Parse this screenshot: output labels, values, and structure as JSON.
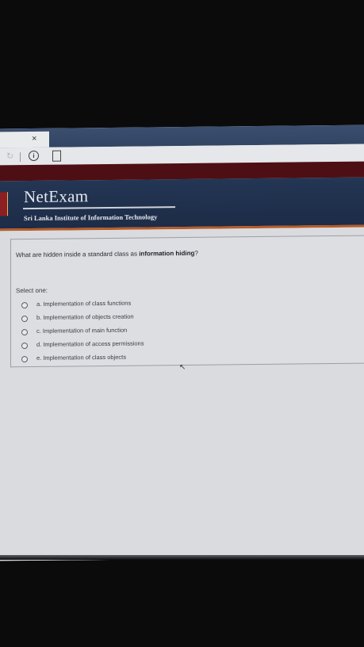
{
  "browser": {
    "close_glyph": "×",
    "reload_glyph": "↻",
    "info_glyph": "i",
    "page_glyph": "▤"
  },
  "header": {
    "app_title": "NetExam",
    "institute": "Sri Lanka Institute of Information Technology"
  },
  "question": {
    "text_prefix": "What are hidden inside a standard class as ",
    "text_bold": "information hiding",
    "text_suffix": "?",
    "select_label": "Select one:",
    "options": [
      {
        "label": "a. Implementation of class functions",
        "selected": false
      },
      {
        "label": "b. Implementation of objects creation",
        "selected": false
      },
      {
        "label": "c. Implementation of main function",
        "selected": false
      },
      {
        "label": "d. Implementation of access permissions",
        "selected": false
      },
      {
        "label": "e. Implementation of class objects",
        "selected": false
      }
    ]
  },
  "colors": {
    "header_bg": "#233654",
    "maroon_bar": "#4e0f14",
    "accent_orange": "#b95b26"
  }
}
